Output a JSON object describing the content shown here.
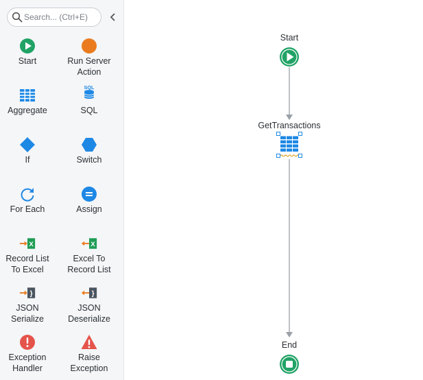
{
  "search": {
    "placeholder": "Search... (Ctrl+E)"
  },
  "toolbox": [
    {
      "label": "Start",
      "icon": "start-icon"
    },
    {
      "label": "Run Server Action",
      "icon": "run-server-action-icon"
    },
    {
      "label": "Aggregate",
      "icon": "aggregate-icon"
    },
    {
      "label": "SQL",
      "icon": "sql-icon"
    },
    {
      "label": "If",
      "icon": "if-icon"
    },
    {
      "label": "Switch",
      "icon": "switch-icon"
    },
    {
      "label": "For Each",
      "icon": "for-each-icon"
    },
    {
      "label": "Assign",
      "icon": "assign-icon"
    },
    {
      "label": "Record List To Excel",
      "icon": "record-list-to-excel-icon"
    },
    {
      "label": "Excel To Record List",
      "icon": "excel-to-record-list-icon"
    },
    {
      "label": "JSON Serialize",
      "icon": "json-serialize-icon"
    },
    {
      "label": "JSON Deserialize",
      "icon": "json-deserialize-icon"
    },
    {
      "label": "Exception Handler",
      "icon": "exception-handler-icon"
    },
    {
      "label": "Raise Exception",
      "icon": "raise-exception-icon"
    }
  ],
  "flow": {
    "start_label": "Start",
    "aggregate_label": "GetTransactions",
    "end_label": "End"
  },
  "colors": {
    "green": "#21a366",
    "orange": "#ea7c1f",
    "blue": "#1e88e5",
    "red": "#e5544b",
    "excel": "#1f9d55"
  }
}
